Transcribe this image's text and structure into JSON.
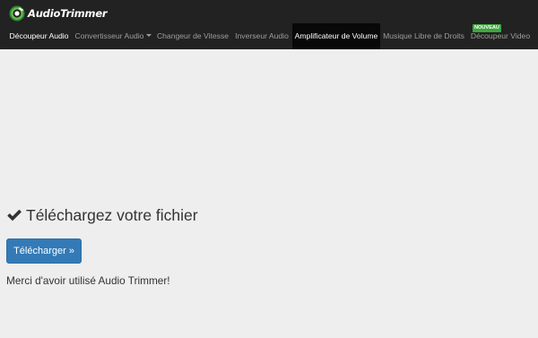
{
  "brand": {
    "name": "AudioTrimmer",
    "icon": "audiotrimmer-logo-icon"
  },
  "nav": {
    "items": [
      {
        "label": "Découpeur Audio"
      },
      {
        "label": "Convertisseur Audio",
        "dropdown": true
      },
      {
        "label": "Changeur de Vitesse"
      },
      {
        "label": "Inverseur Audio"
      },
      {
        "label": "Amplificateur de Volume",
        "active": true
      },
      {
        "label": "Musique Libre de Droits"
      },
      {
        "label": "Découpeur Video",
        "badge": "NOUVEAU"
      }
    ]
  },
  "main": {
    "heading": "Téléchargez votre fichier",
    "heading_icon": "checkmark-icon",
    "upload_button": "Télécharger »",
    "thanks": "Merci d'avoir utilisé Audio Trimmer!"
  },
  "colors": {
    "navbar_bg": "#222222",
    "nav_active_bg": "#080808",
    "nav_text": "#9d9d9d",
    "page_bg": "#eeeeee",
    "primary_button": "#337ab7",
    "badge_green": "#3fa63f",
    "text": "#333333"
  }
}
